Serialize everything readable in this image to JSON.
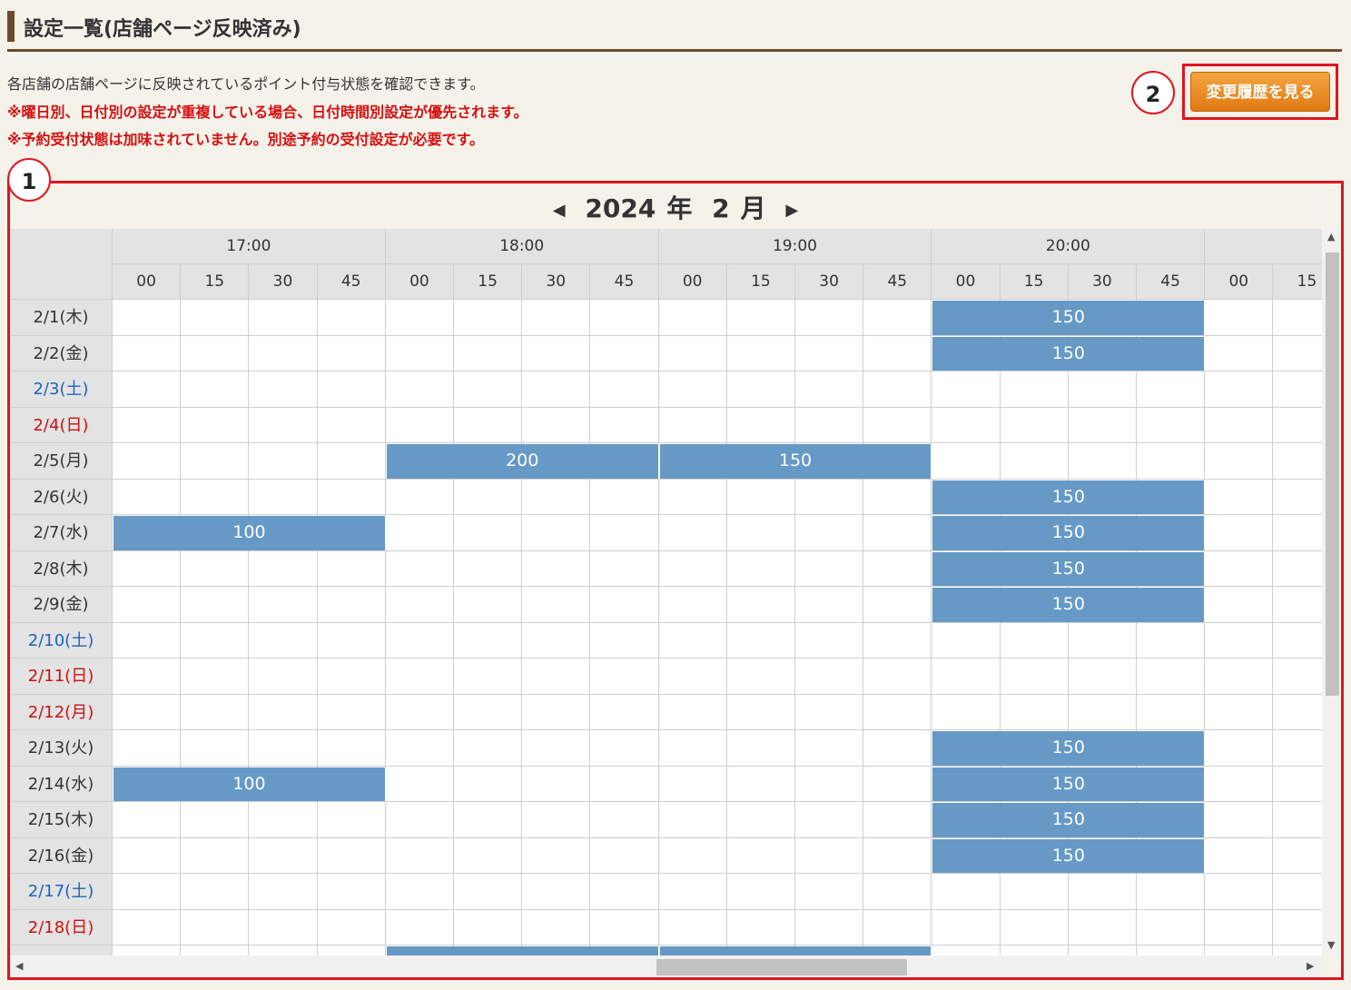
{
  "page": {
    "title": "設定一覧(店舗ページ反映済み)",
    "desc": "各店舗の店舗ページに反映されているポイント付与状態を確認できます。",
    "note1": "※曜日別、日付別の設定が重複している場合、日付時間別設定が優先されます。",
    "note2": "※予約受付状態は加味されていません。別途予約の受付設定が必要です。",
    "history_button": "変更履歴を見る",
    "badge1": "1",
    "badge2": "2"
  },
  "calendar": {
    "year": "2024",
    "year_unit": "年",
    "month": "2",
    "month_unit": "月",
    "prev_icon": "◀",
    "next_icon": "▶",
    "hours": [
      "17:00",
      "18:00",
      "19:00",
      "20:00",
      ""
    ],
    "minutes": [
      "00",
      "15",
      "30",
      "45",
      "00",
      "15",
      "30",
      "45",
      "00",
      "15",
      "30",
      "45",
      "00",
      "15",
      "30",
      "45",
      "00",
      "15"
    ],
    "rows": [
      {
        "date": "2/1(木)",
        "type": "weekday",
        "blocks": [
          {
            "start": 12,
            "span": 4,
            "value": "150"
          }
        ]
      },
      {
        "date": "2/2(金)",
        "type": "weekday",
        "blocks": [
          {
            "start": 12,
            "span": 4,
            "value": "150"
          }
        ]
      },
      {
        "date": "2/3(土)",
        "type": "sat",
        "blocks": []
      },
      {
        "date": "2/4(日)",
        "type": "sun",
        "blocks": []
      },
      {
        "date": "2/5(月)",
        "type": "weekday",
        "blocks": [
          {
            "start": 4,
            "span": 4,
            "value": "200"
          },
          {
            "start": 8,
            "span": 4,
            "value": "150"
          }
        ]
      },
      {
        "date": "2/6(火)",
        "type": "weekday",
        "blocks": [
          {
            "start": 12,
            "span": 4,
            "value": "150"
          }
        ]
      },
      {
        "date": "2/7(水)",
        "type": "weekday",
        "blocks": [
          {
            "start": 0,
            "span": 4,
            "value": "100"
          },
          {
            "start": 12,
            "span": 4,
            "value": "150"
          }
        ]
      },
      {
        "date": "2/8(木)",
        "type": "weekday",
        "blocks": [
          {
            "start": 12,
            "span": 4,
            "value": "150"
          }
        ]
      },
      {
        "date": "2/9(金)",
        "type": "weekday",
        "blocks": [
          {
            "start": 12,
            "span": 4,
            "value": "150"
          }
        ]
      },
      {
        "date": "2/10(土)",
        "type": "sat",
        "blocks": []
      },
      {
        "date": "2/11(日)",
        "type": "sun",
        "blocks": []
      },
      {
        "date": "2/12(月)",
        "type": "sun",
        "blocks": []
      },
      {
        "date": "2/13(火)",
        "type": "weekday",
        "blocks": [
          {
            "start": 12,
            "span": 4,
            "value": "150"
          }
        ]
      },
      {
        "date": "2/14(水)",
        "type": "weekday",
        "blocks": [
          {
            "start": 0,
            "span": 4,
            "value": "100"
          },
          {
            "start": 12,
            "span": 4,
            "value": "150"
          }
        ]
      },
      {
        "date": "2/15(木)",
        "type": "weekday",
        "blocks": [
          {
            "start": 12,
            "span": 4,
            "value": "150"
          }
        ]
      },
      {
        "date": "2/16(金)",
        "type": "weekday",
        "blocks": [
          {
            "start": 12,
            "span": 4,
            "value": "150"
          }
        ]
      },
      {
        "date": "2/17(土)",
        "type": "sat",
        "blocks": []
      },
      {
        "date": "2/18(日)",
        "type": "sun",
        "blocks": []
      },
      {
        "date": "",
        "type": "weekday",
        "blocks": [
          {
            "start": 4,
            "span": 4,
            "value": ""
          },
          {
            "start": 8,
            "span": 4,
            "value": ""
          }
        ]
      }
    ]
  },
  "colors": {
    "block": "#6699c6",
    "sat": "#1c62c0",
    "sun": "#cc1010",
    "highlight": "#e0151f"
  },
  "icons": {
    "scroll_up": "▲",
    "scroll_down": "▼",
    "scroll_left": "◀",
    "scroll_right": "▶"
  }
}
